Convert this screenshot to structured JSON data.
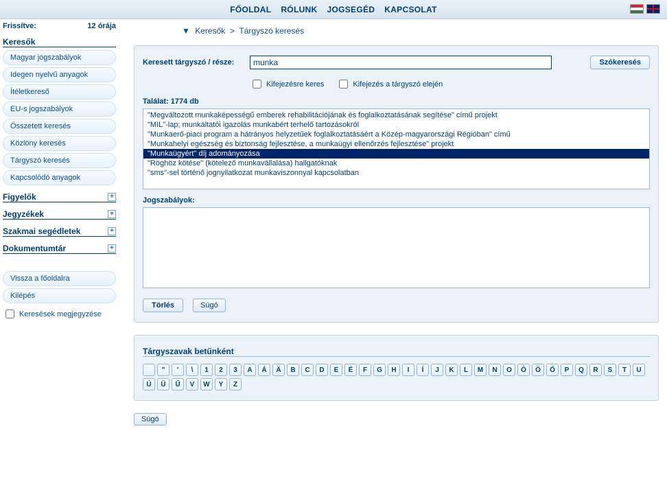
{
  "top_nav": [
    "FŐOLDAL",
    "RÓLUNK",
    "JOGSEGÉD",
    "KAPCSOLAT"
  ],
  "frissitve_label": "Frissítve:",
  "frissitve_value": "12 órája",
  "sidebar": {
    "keresok_title": "Keresők",
    "keresok_items": [
      "Magyar jogszabályok",
      "Idegen nyelvű anyagok",
      "Ítéletkereső",
      "EU-s jogszabályok",
      "Összetett keresés",
      "Közlöny keresés",
      "Tárgyszó keresés",
      "Kapcsolódó anyagok"
    ],
    "collapsible": [
      "Figyelők",
      "Jegyzékek",
      "Szakmai segédletek",
      "Dokumentumtár"
    ],
    "bottom_items": [
      "Vissza a főoldalra",
      "Kilépés"
    ],
    "remember_label": "Keresések megjegyzése"
  },
  "breadcrumb": {
    "part1": "Keresők",
    "sep": ">",
    "part2": "Tárgyszó keresés"
  },
  "search": {
    "label": "Keresett tárgyszó / része:",
    "value": "munka",
    "button": "Szókeresés",
    "chk1": "Kifejezésre keres",
    "chk2": "Kifejezés a tárgyszó elején"
  },
  "hits": {
    "label": "Találat:",
    "count": "1774",
    "suffix": "db"
  },
  "results": [
    "\"Megváltozott munkaképességű emberek rehabilitációjának és foglalkoztatásának segítése\" című projekt",
    "\"MIL\"-lap; munkáltatói igazolás munkabért terhelő tartozásokról",
    "\"Munkaerő-piaci program a hátrányos helyzetűek foglalkoztatásáért a Közép-magyarországi Régióban\" című",
    "\"Munkahelyi egészség és biztonság fejlesztése, a munkaügyi ellenőrzés fejlesztése\" projekt",
    "\"Munkaügyért\" díj adományozása",
    "\"Röghöz kötése\" (kötelező munkavállalása) hallgatóknak",
    "\"sms\"-sel történő jognyilatkozat munkaviszonnyal kapcsolatban"
  ],
  "results_selected_index": 4,
  "jog_label": "Jogszabályok:",
  "buttons": {
    "torles": "Törlés",
    "sugo": "Súgó"
  },
  "alpha_title": "Tárgyszavak betűnként",
  "alpha": [
    "",
    "\"",
    "'",
    "\\",
    "1",
    "2",
    "3",
    "A",
    "Á",
    "Ä",
    "B",
    "C",
    "D",
    "E",
    "É",
    "F",
    "G",
    "H",
    "I",
    "Í",
    "J",
    "K",
    "L",
    "M",
    "N",
    "O",
    "Ó",
    "Ö",
    "Ő",
    "P",
    "Q",
    "R",
    "S",
    "T",
    "U",
    "Ú",
    "Ü",
    "Ű",
    "V",
    "W",
    "Y",
    "Z"
  ]
}
